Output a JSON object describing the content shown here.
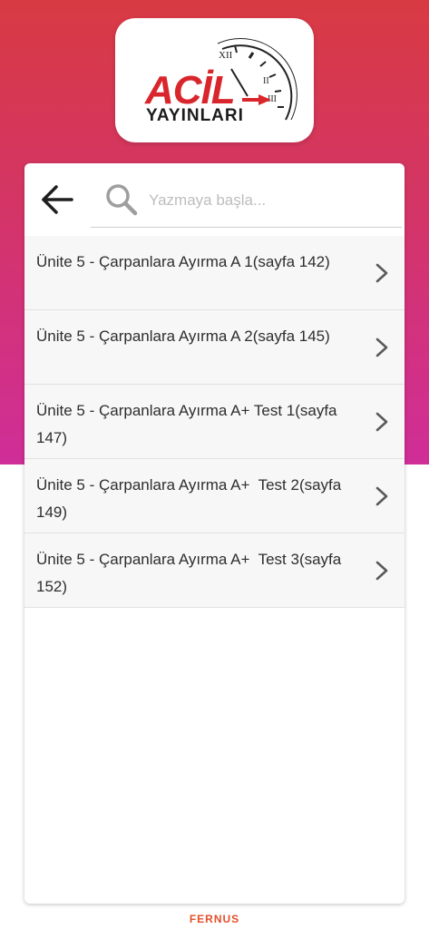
{
  "header": {
    "logo": {
      "brand_top": "ACİL",
      "brand_bottom": "YAYINLARI",
      "clock_numeral": "XII",
      "icon": "clock-logo-icon",
      "brand_color": "#d9262c"
    }
  },
  "search": {
    "back_icon": "arrow-left-icon",
    "search_icon": "search-icon",
    "placeholder": "Yazmaya başla...",
    "value": ""
  },
  "list": {
    "items": [
      {
        "label": "Ünite 5 - Çarpanlara Ayırma A 1(sayfa 142)"
      },
      {
        "label": "Ünite 5 - Çarpanlara Ayırma A 2(sayfa 145)"
      },
      {
        "label": "Ünite 5 - Çarpanlara Ayırma A+ Test 1(sayfa 147)"
      },
      {
        "label": "Ünite 5 - Çarpanlara Ayırma A+  Test 2(sayfa 149)"
      },
      {
        "label": "Ünite 5 - Çarpanlara Ayırma A+  Test 3(sayfa 152)"
      }
    ],
    "chevron_icon": "chevron-right-icon"
  },
  "footer": {
    "brand": "FERNUS"
  },
  "colors": {
    "gradient_top": "#d83a43",
    "gradient_bottom": "#d02e98",
    "footer_brand": "#e2502a"
  }
}
